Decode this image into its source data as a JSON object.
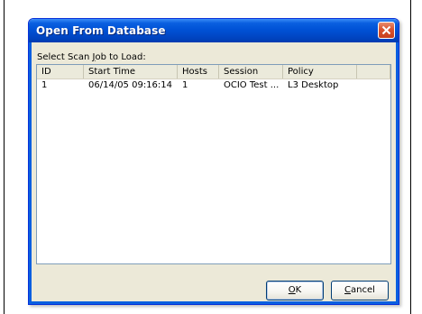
{
  "dialog": {
    "title": "Open From Database",
    "close_icon": "close-icon"
  },
  "prompt": {
    "before": "Select Scan ",
    "underlined": "J",
    "after": "ob to Load:"
  },
  "list": {
    "columns": [
      "ID",
      "Start Time",
      "Hosts",
      "Session",
      "Policy",
      ""
    ],
    "rows": [
      {
        "id": "1",
        "start_time": "06/14/05 09:16:14",
        "hosts": "1",
        "session": "OCIO Test ...",
        "policy": "L3 Desktop"
      }
    ]
  },
  "buttons": {
    "ok": {
      "underlined": "O",
      "rest": "K"
    },
    "cancel": {
      "underlined": "C",
      "rest": "ancel"
    }
  },
  "colors": {
    "titlebar": "#0052d6",
    "dialog_bg": "#ece9d8",
    "close_button": "#d9532f"
  }
}
